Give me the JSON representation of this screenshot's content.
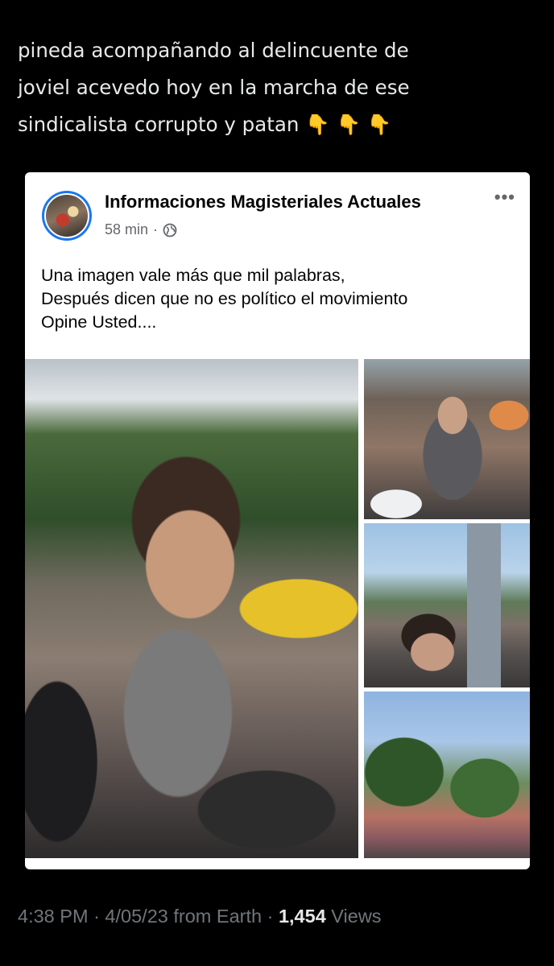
{
  "tweet": {
    "text_line1": "pineda acompañando al delincuente de",
    "text_line2": "joviel acevedo hoy en la marcha de ese",
    "text_line3": "sindicalista corrupto y patan",
    "emojis": "👇 👇 👇"
  },
  "embedded_post": {
    "page_name": "Informaciones Magisteriales Actuales",
    "time_ago": "58 min",
    "separator": "·",
    "more_icon": "more-horizontal-icon",
    "audience_icon": "globe-icon",
    "text_line1": "Una imagen vale más que mil palabras,",
    "text_line2": "Después dicen que no es político el movimiento",
    "text_line3": "Opine Usted...."
  },
  "meta": {
    "time": "4:38 PM",
    "sep1": "·",
    "date": "4/05/23",
    "source": "from Earth",
    "sep2": "·",
    "views_count": "1,454",
    "views_label": "Views"
  }
}
